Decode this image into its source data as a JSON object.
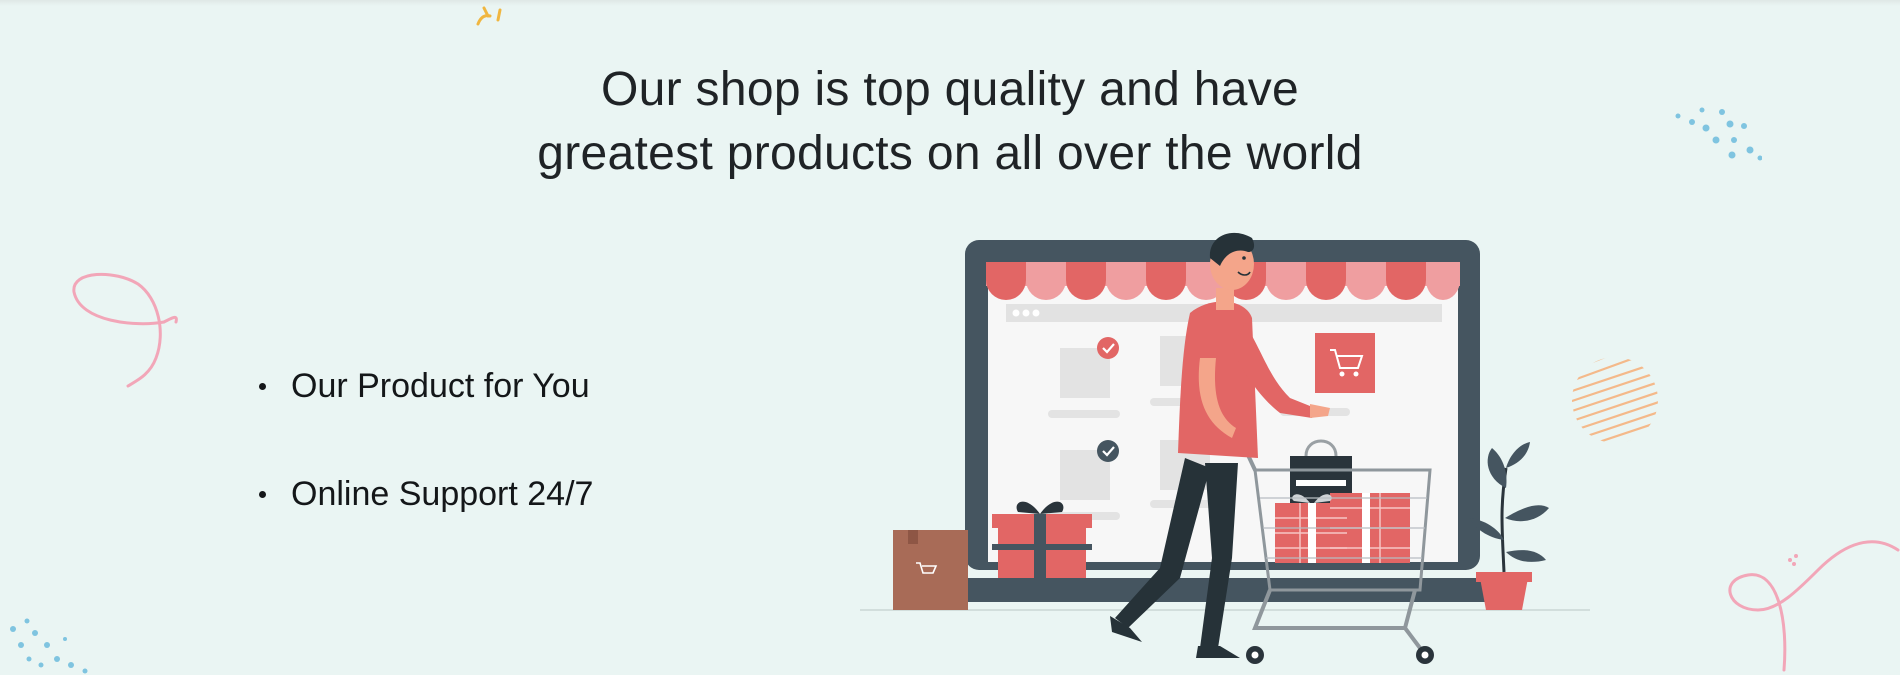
{
  "headline": {
    "line1": "Our shop is top quality and have",
    "line2": "greatest products on all over the world"
  },
  "features": [
    {
      "label": "Our Product for You"
    },
    {
      "label": "Online Support 24/7"
    }
  ],
  "colors": {
    "background": "#eaf5f3",
    "accent_red": "#e26665",
    "accent_pink": "#f0a0a3",
    "dark_slate": "#455560",
    "text": "#1f2326"
  },
  "icons": [
    "shopping-cart-icon",
    "check-icon",
    "gift-box-icon",
    "plant-icon"
  ]
}
